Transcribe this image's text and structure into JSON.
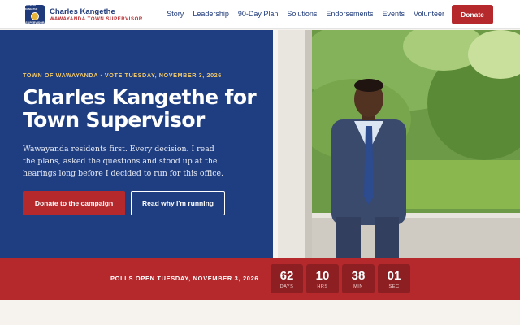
{
  "header": {
    "brand_name": "Charles Kangethe",
    "brand_sub": "WAWAYANDA TOWN SUPERVISOR",
    "logo_text_top": "CHARLES KANGETHE",
    "logo_text_bottom": "SUPERVISOR",
    "nav": [
      "Story",
      "Leadership",
      "90-Day Plan",
      "Solutions",
      "Endorsements",
      "Events",
      "Volunteer"
    ],
    "donate_label": "Donate"
  },
  "hero": {
    "eyebrow": "TOWN OF WAWAYANDA · VOTE TUESDAY, NOVEMBER 3, 2026",
    "headline": "Charles Kangethe for Town Supervisor",
    "lede": "Wawayanda residents first. Every decision. I read the plans, asked the questions and stood up at the hearings long before I decided to run for this office.",
    "primary_cta": "Donate to the campaign",
    "secondary_cta": "Read why I'm running"
  },
  "countdown": {
    "label": "POLLS OPEN TUESDAY, NOVEMBER 3, 2026",
    "items": [
      {
        "value": "62",
        "unit": "DAYS"
      },
      {
        "value": "10",
        "unit": "HRS"
      },
      {
        "value": "38",
        "unit": "MIN"
      },
      {
        "value": "01",
        "unit": "SEC"
      }
    ]
  },
  "colors": {
    "navy": "#1f3e82",
    "red": "#b5292d",
    "gold": "#f0c76a"
  }
}
